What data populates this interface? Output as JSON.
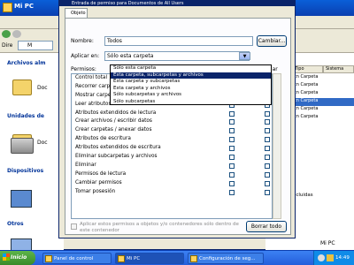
{
  "explorer": {
    "title": "Mi PC",
    "address_label": "Dire",
    "address_value": "M",
    "side_sections": [
      "Archivos alm",
      "Unidades de",
      "Dispositivos",
      "Otros"
    ],
    "side_items": [
      "Doc",
      "Doc"
    ],
    "right_headers": [
      "Tipo",
      "Sistema"
    ],
    "right_rows": [
      {
        "a": "cn",
        "b": "Carpeta"
      },
      {
        "a": "cn",
        "b": "Carpeta"
      },
      {
        "a": "cn",
        "b": "Carpeta"
      },
      {
        "a": "cn",
        "b": "Carpeta",
        "selected": true
      },
      {
        "a": "cn",
        "b": "Carpeta"
      },
      {
        "a": "cn",
        "b": "Carpeta"
      }
    ],
    "right_bottom_text": "Mi PC",
    "status_text": "ersonas incluidas"
  },
  "dialog": {
    "title": "Entrada de permiso para Documentos de All Users",
    "tab_label": "Objeto",
    "name_label": "Nombre:",
    "name_value": "Todos",
    "change_button": "Cambiar...",
    "apply_label": "Aplicar en:",
    "apply_value": "Sólo esta carpeta",
    "dropdown_options": [
      {
        "label": "Sólo esta carpeta",
        "selected": false
      },
      {
        "label": "Esta carpeta, subcarpetas y archivos",
        "selected": true
      },
      {
        "label": "Esta carpeta y subcarpetas",
        "selected": false
      },
      {
        "label": "Esta carpeta y archivos",
        "selected": false
      },
      {
        "label": "Sólo subcarpetas y archivos",
        "selected": false
      },
      {
        "label": "Sólo subcarpetas",
        "selected": false
      }
    ],
    "permissions_header": "Permisos:",
    "deny_header": "Denegar",
    "permissions": [
      {
        "label": "Control total",
        "allow": false,
        "deny": false
      },
      {
        "label": "Recorrer carpeta / ejecutar archivo",
        "allow": false,
        "deny": false
      },
      {
        "label": "Mostrar carpeta / leer datos",
        "allow": false,
        "deny": false
      },
      {
        "label": "Leer atributos",
        "allow": false,
        "deny": false
      },
      {
        "label": "Atributos extendidos de lectura",
        "allow": false,
        "deny": false
      },
      {
        "label": "Crear archivos / escribir datos",
        "allow": false,
        "deny": false
      },
      {
        "label": "Crear carpetas / anexar datos",
        "allow": false,
        "deny": false
      },
      {
        "label": "Atributos de escritura",
        "allow": false,
        "deny": false
      },
      {
        "label": "Atributos extendidos de escritura",
        "allow": false,
        "deny": false
      },
      {
        "label": "Eliminar subcarpetas y archivos",
        "allow": false,
        "deny": false
      },
      {
        "label": "Eliminar",
        "allow": false,
        "deny": false
      },
      {
        "label": "Permisos de lectura",
        "allow": false,
        "deny": false
      },
      {
        "label": "Cambiar permisos",
        "allow": false,
        "deny": false
      },
      {
        "label": "Tomar posesión",
        "allow": false,
        "deny": false
      }
    ],
    "apply_inherit_text": "Aplicar estos permisos a objetos y/o contenedores sólo dentro de este contenedor",
    "clear_button": "Borrar todo"
  },
  "taskbar": {
    "start_label": "Inicio",
    "buttons": [
      "Panel de control",
      "Mi PC",
      "Configuración de seg..."
    ],
    "clock": "14:49"
  }
}
